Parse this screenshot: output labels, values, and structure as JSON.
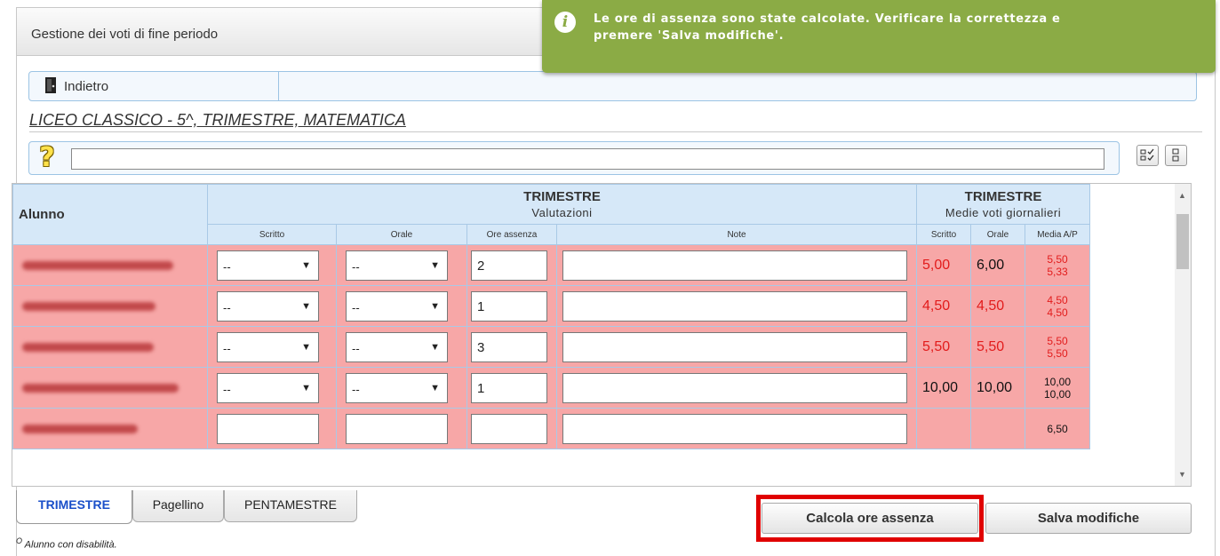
{
  "header": {
    "title": "Gestione dei voti di fine periodo"
  },
  "notice": {
    "icon": "info-icon",
    "icon_glyph": "i",
    "line1": "Le ore di assenza sono state calcolate. Verificare la correttezza e",
    "line2": "premere 'Salva modifiche'.",
    "color": "#8bab45"
  },
  "nav": {
    "back_label": "Indietro"
  },
  "class_title": "LICEO CLASSICO - 5^, TRIMESTRE, MATEMATICA",
  "search": {
    "help_glyph": "?",
    "value": ""
  },
  "grid": {
    "col_alunno": "Alunno",
    "group1": {
      "title": "TRIMESTRE",
      "subtitle": "Valutazioni"
    },
    "group2": {
      "title": "TRIMESTRE",
      "subtitle": "Medie voti giornalieri"
    },
    "subheaders": [
      "Scritto",
      "Orale",
      "Ore assenza",
      "Note",
      "Scritto",
      "Orale",
      "Media A/P"
    ],
    "select_arrow": "▼",
    "rows": [
      {
        "scritto": "--",
        "orale": "--",
        "ore": "2",
        "note": "",
        "avg_scritto": "5,00",
        "avg_orale": "6,00",
        "media_a": "5,50",
        "media_p": "5,33",
        "sc_red": true,
        "or_red": false,
        "mp_red": true
      },
      {
        "scritto": "--",
        "orale": "--",
        "ore": "1",
        "note": "",
        "avg_scritto": "4,50",
        "avg_orale": "4,50",
        "media_a": "4,50",
        "media_p": "4,50",
        "sc_red": true,
        "or_red": true,
        "mp_red": true
      },
      {
        "scritto": "--",
        "orale": "--",
        "ore": "3",
        "note": "",
        "avg_scritto": "5,50",
        "avg_orale": "5,50",
        "media_a": "5,50",
        "media_p": "5,50",
        "sc_red": true,
        "or_red": true,
        "mp_red": true
      },
      {
        "scritto": "--",
        "orale": "--",
        "ore": "1",
        "note": "",
        "avg_scritto": "10,00",
        "avg_orale": "10,00",
        "media_a": "10,00",
        "media_p": "10,00",
        "sc_red": false,
        "or_red": false,
        "mp_red": false
      },
      {
        "scritto": "",
        "orale": "",
        "ore": "",
        "note": "",
        "avg_scritto": "",
        "avg_orale": "",
        "media_a": "6,50",
        "media_p": "",
        "sc_red": false,
        "or_red": false,
        "mp_red": false
      }
    ]
  },
  "tabs": [
    "TRIMESTRE",
    "Pagellino",
    "PENTAMESTRE"
  ],
  "buttons": {
    "calc": "Calcola ore assenza",
    "save": "Salva modifiche"
  },
  "footnote": {
    "mark": "O",
    "text": " Alunno con disabilità."
  },
  "colors": {
    "row_bg": "#f7a7a7",
    "header_bg": "#d6e8f8",
    "red_value": "#e21c1c",
    "highlight": "#e00000",
    "active_tab": "#1a4fc9"
  }
}
